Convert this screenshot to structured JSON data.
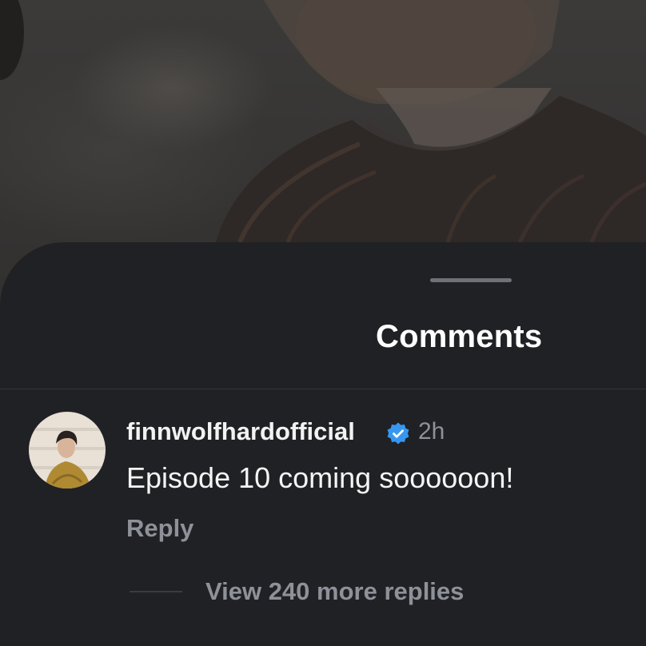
{
  "comments_sheet": {
    "title": "Comments"
  },
  "comment": {
    "username": "finnwolfhardofficial",
    "verified_icon": "verified-badge-icon",
    "time": "2h",
    "text": "Episode 10 coming soooooon!",
    "reply_label": "Reply",
    "view_replies_label": "View 240 more replies"
  },
  "colors": {
    "sheet_background": "#202125",
    "verified_blue": "#3797f0",
    "muted_text": "#8e9199"
  }
}
